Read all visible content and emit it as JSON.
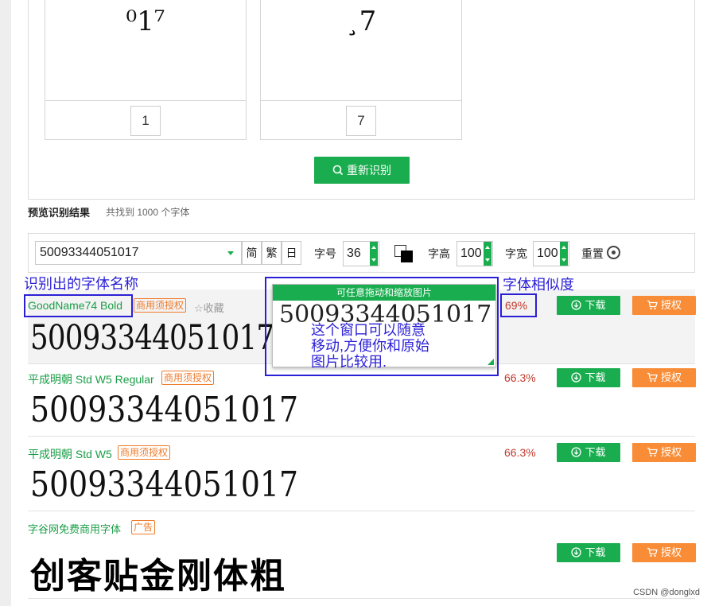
{
  "recognition": {
    "cards": [
      {
        "glyph": "⁰1⁷",
        "value": "1"
      },
      {
        "glyph": "¸7",
        "value": "7"
      }
    ],
    "reidentify_label": "重新识别"
  },
  "results": {
    "title": "预览识别结果",
    "count_text": "共找到 1000 个字体"
  },
  "toolbar": {
    "text_value": "50093344051017",
    "simplified": "简",
    "traditional": "繁",
    "japanese": "日",
    "size_label": "字号",
    "size_value": "36",
    "height_label": "字高",
    "height_value": "100",
    "width_label": "字宽",
    "width_value": "100",
    "reset_label": "重置"
  },
  "fonts": [
    {
      "name": "GoodName74 Bold",
      "license": "商用须授权",
      "favorite": "☆收藏",
      "similarity": "69%",
      "sample": "50093344051017",
      "download": "下载",
      "authorize": "授权"
    },
    {
      "name": "平成明朝 Std W5 Regular",
      "license": "商用须授权",
      "similarity": "66.3%",
      "sample": "50093344051017",
      "download": "下载",
      "authorize": "授权"
    },
    {
      "name": "平成明朝 Std W5",
      "license": "商用须授权",
      "similarity": "66.3%",
      "sample": "50093344051017",
      "download": "下载",
      "authorize": "授权"
    },
    {
      "name": "字谷网免费商用字体",
      "license": "广告",
      "sample": "创客贴金刚体粗",
      "download": "下载",
      "authorize": "授权"
    }
  ],
  "overlay": {
    "header": "可任意拖动和缩放图片",
    "sample": "50093344051017"
  },
  "annotations": {
    "font_name_note": "识别出的字体名称",
    "similarity_note": "字体相似度",
    "window_note_line1": "这个窗口可以随意",
    "window_note_line2": "移动,方便你和原始",
    "window_note_line3": "图片比较用."
  },
  "watermark": "CSDN @donglxd",
  "colors": {
    "green": "#1aad4f",
    "orange": "#f98c36",
    "annotation_blue": "#2b1fd6",
    "similarity_red": "#c0392b"
  }
}
